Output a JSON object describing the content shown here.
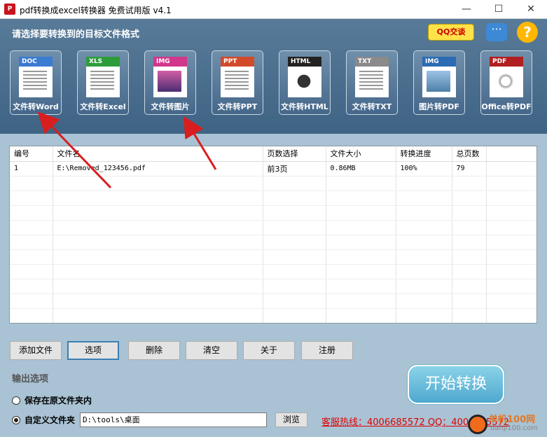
{
  "window": {
    "title": "pdf转换成excel转换器 免费试用版 v4.1",
    "minimize": "—",
    "maximize": "☐",
    "close": "✕"
  },
  "header": {
    "prompt": "请选择要转换到的目标文件格式",
    "qq_label": "QQ交谈"
  },
  "tools": [
    {
      "tag": "DOC",
      "label": "文件转Word",
      "color": "#3b7bd1"
    },
    {
      "tag": "XLS",
      "label": "文件转Excel",
      "color": "#2f9c3b"
    },
    {
      "tag": "IMG",
      "label": "文件转图片",
      "color": "#d1378a"
    },
    {
      "tag": "PPT",
      "label": "文件转PPT",
      "color": "#d14a2a"
    },
    {
      "tag": "HTML",
      "label": "文件转HTML",
      "color": "#222222"
    },
    {
      "tag": "TXT",
      "label": "文件转TXT",
      "color": "#8a8a8a"
    },
    {
      "tag": "IMG",
      "label": "图片转PDF",
      "color": "#2b6bb3"
    },
    {
      "tag": "PDF",
      "label": "Office转PDF",
      "color": "#b02020"
    }
  ],
  "table": {
    "headers": [
      "编号",
      "文件名",
      "页数选择",
      "文件大小",
      "转换进度",
      "总页数"
    ],
    "rows": [
      [
        "1",
        "E:\\Removed_123456.pdf",
        "前3页",
        "0.86MB",
        "100%",
        "79"
      ]
    ]
  },
  "buttons": {
    "add_file": "添加文件",
    "options": "选项",
    "delete": "删除",
    "clear": "清空",
    "about": "关于",
    "register": "注册",
    "start": "开始转换",
    "browse": "浏览"
  },
  "output": {
    "section_label": "输出选项",
    "keep_original": "保存在原文件夹内",
    "custom_folder": "自定义文件夹",
    "path_value": "D:\\tools\\桌面"
  },
  "hotline": "客服热线：4006685572 QQ：4006685572",
  "watermark": {
    "text": "单机100网",
    "sub": "danji100.com"
  }
}
